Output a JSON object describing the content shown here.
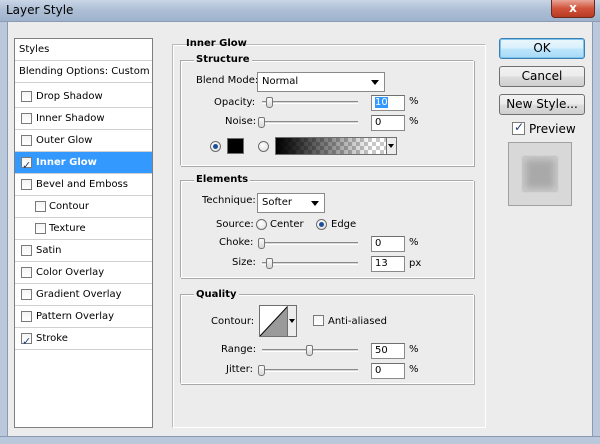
{
  "window": {
    "title": "Layer Style",
    "close_label": "x"
  },
  "styles_list": {
    "header": "Styles",
    "blending": "Blending Options: Custom",
    "items": [
      {
        "label": "Drop Shadow",
        "checked": false
      },
      {
        "label": "Inner Shadow",
        "checked": false
      },
      {
        "label": "Outer Glow",
        "checked": false
      },
      {
        "label": "Inner Glow",
        "checked": true
      },
      {
        "label": "Bevel and Emboss",
        "checked": false
      },
      {
        "label": "Contour",
        "checked": false
      },
      {
        "label": "Texture",
        "checked": false
      },
      {
        "label": "Satin",
        "checked": false
      },
      {
        "label": "Color Overlay",
        "checked": false
      },
      {
        "label": "Gradient Overlay",
        "checked": false
      },
      {
        "label": "Pattern Overlay",
        "checked": false
      },
      {
        "label": "Stroke",
        "checked": true
      }
    ],
    "selected": "Inner Glow"
  },
  "panel": {
    "title": "Inner Glow",
    "structure": {
      "title": "Structure",
      "blend_mode_label": "Blend Mode:",
      "blend_mode_value": "Normal",
      "opacity_label": "Opacity:",
      "opacity_value": "10",
      "opacity_unit": "%",
      "noise_label": "Noise:",
      "noise_value": "0",
      "noise_unit": "%",
      "glow_color": "#000000",
      "color_mode": "solid"
    },
    "elements": {
      "title": "Elements",
      "technique_label": "Technique:",
      "technique_value": "Softer",
      "source_label": "Source:",
      "source_center": "Center",
      "source_edge": "Edge",
      "source_selected": "Edge",
      "choke_label": "Choke:",
      "choke_value": "0",
      "choke_unit": "%",
      "size_label": "Size:",
      "size_value": "13",
      "size_unit": "px"
    },
    "quality": {
      "title": "Quality",
      "contour_label": "Contour:",
      "anti_aliased_label": "Anti-aliased",
      "anti_aliased_checked": false,
      "range_label": "Range:",
      "range_value": "50",
      "range_unit": "%",
      "jitter_label": "Jitter:",
      "jitter_value": "0",
      "jitter_unit": "%"
    }
  },
  "buttons": {
    "ok": "OK",
    "cancel": "Cancel",
    "new_style": "New Style...",
    "preview": "Preview",
    "preview_checked": true
  },
  "colors": {
    "selection": "#3399ff",
    "window_bg": "#ececec"
  }
}
